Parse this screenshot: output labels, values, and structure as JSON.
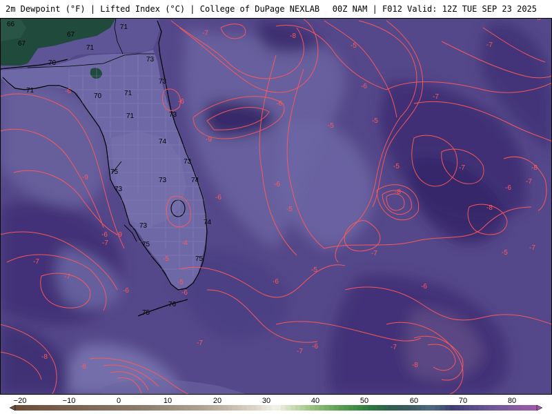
{
  "header": {
    "left_text": "2m Dewpoint (°F) | Lifted Index (°C) | College of DuPage NEXLAB",
    "right_text": "00Z NAM | F012 Valid: 12Z TUE SEP 23 2025"
  },
  "colors": {
    "ocean_base": "#55488a",
    "ocean_dark": "#3f2f74",
    "ocean_light": "#6e67a3",
    "land_green": "#1f4a3c",
    "li_contour": "#ff5a5a",
    "coast": "#000000"
  },
  "dewpoint_labels": [
    "66",
    "67",
    "67",
    "67",
    "71",
    "71",
    "70",
    "71",
    "70",
    "71",
    "71",
    "73",
    "73",
    "73",
    "74",
    "73",
    "73",
    "74",
    "73",
    "73",
    "74",
    "75",
    "75",
    "76",
    "75",
    "75"
  ],
  "lifted_index_labels": [
    "-7",
    "-8",
    "-8",
    "-5",
    "-6",
    "-7",
    "-6",
    "-6",
    "-5",
    "-9",
    "-9",
    "-6",
    "-8",
    "-9",
    "-5",
    "-7",
    "-5",
    "-7",
    "-6",
    "-4",
    "-6",
    "-5",
    "-6",
    "-6",
    "-5",
    "-7",
    "-6",
    "-8",
    "-7",
    "-8",
    "-7",
    "-8",
    "-6",
    "-7",
    "-6",
    "-7",
    "-5",
    "-7",
    "-7",
    "-8",
    "-6",
    "-7",
    "-5",
    "-8",
    "-7",
    "-6",
    "-5"
  ],
  "colorbar": {
    "tick_labels": [
      "−20",
      "−10",
      "0",
      "10",
      "20",
      "30",
      "40",
      "50",
      "60",
      "70",
      "80"
    ],
    "units": "°F"
  }
}
